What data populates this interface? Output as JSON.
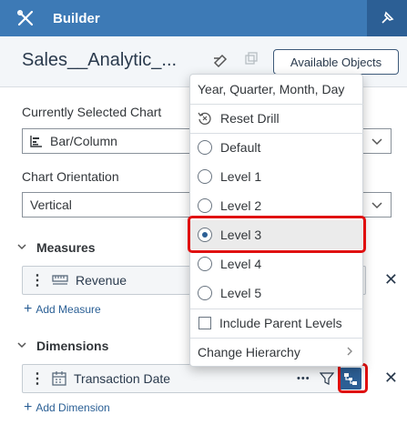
{
  "header": {
    "title": "Builder"
  },
  "subheader": {
    "model_name": "Sales__Analytic_...",
    "available_objects": "Available Objects"
  },
  "chart": {
    "selected_label": "Currently Selected Chart",
    "selected_value": "Bar/Column",
    "orientation_label": "Chart Orientation",
    "orientation_value": "Vertical"
  },
  "measures": {
    "title": "Measures",
    "items": [
      {
        "label": "Revenue"
      }
    ],
    "add_label": "Add Measure"
  },
  "dimensions": {
    "title": "Dimensions",
    "items": [
      {
        "label": "Transaction Date"
      }
    ],
    "add_label": "Add Dimension",
    "more": "•••"
  },
  "popover": {
    "header": "Year, Quarter, Month, Day",
    "reset": "Reset Drill",
    "levels": [
      "Default",
      "Level 1",
      "Level 2",
      "Level 3",
      "Level 4",
      "Level 5"
    ],
    "selected_level": "Level 3",
    "include_parent": "Include Parent Levels",
    "change_hierarchy": "Change Hierarchy"
  }
}
